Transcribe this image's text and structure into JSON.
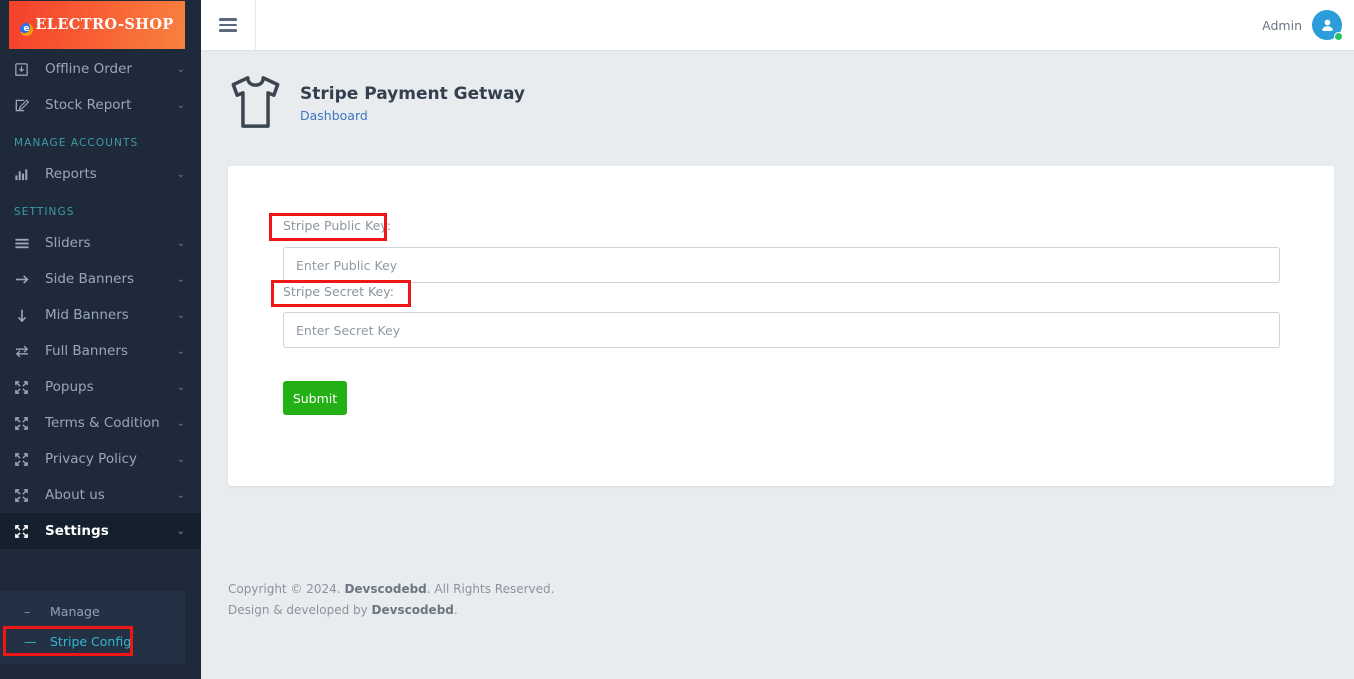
{
  "brand": {
    "logo_badge": "e",
    "logo_text": "ELECTRO-SHOP",
    "logo_gradient_from": "#f4402b",
    "logo_gradient_to": "#f9813f"
  },
  "topbar": {
    "hamburger_icon": "hamburger-icon",
    "user_name": "Admin",
    "avatar_icon": "user-avatar-icon",
    "status_color": "#22c55e"
  },
  "sidebar": {
    "background": "#1e2a3a",
    "accent": "#2fb8cf",
    "items": [
      {
        "label": "Offline Order",
        "icon": "inbox-download-icon",
        "chevron": "⌄",
        "has_children": true
      },
      {
        "label": "Stock Report",
        "icon": "edit-square-icon",
        "chevron": "⌄",
        "has_children": true
      }
    ],
    "section_manage_accounts": "MANAGE ACCOUNTS",
    "items_manage": [
      {
        "label": "Reports",
        "icon": "bar-chart-icon",
        "chevron": "⌄",
        "has_children": true
      }
    ],
    "section_settings": "SETTINGS",
    "items_settings": [
      {
        "label": "Sliders",
        "icon": "bars-icon",
        "chevron": "⌄",
        "has_children": true
      },
      {
        "label": "Side Banners",
        "icon": "arrow-right-icon",
        "chevron": "⌄",
        "has_children": true
      },
      {
        "label": "Mid Banners",
        "icon": "arrow-down-icon",
        "chevron": "⌄",
        "has_children": true
      },
      {
        "label": "Full Banners",
        "icon": "exchange-arrows-icon",
        "chevron": "⌄",
        "has_children": true
      },
      {
        "label": "Popups",
        "icon": "expand-arrows-icon",
        "chevron": "⌄",
        "has_children": true
      },
      {
        "label": "Terms & Codition",
        "icon": "expand-arrows-icon",
        "chevron": "⌄",
        "has_children": true
      },
      {
        "label": "Privacy Policy",
        "icon": "expand-arrows-icon",
        "chevron": "⌄",
        "has_children": true
      },
      {
        "label": "About us",
        "icon": "expand-arrows-icon",
        "chevron": "⌄",
        "has_children": true
      },
      {
        "label": "Settings",
        "icon": "expand-arrows-icon",
        "chevron": "⌄",
        "has_children": true,
        "active": true
      }
    ],
    "settings_submenu": [
      {
        "label": "Manage",
        "marker": "–",
        "current": false
      },
      {
        "label": "Stripe Config",
        "marker": "—",
        "current": true
      }
    ]
  },
  "page": {
    "icon": "tshirt-icon",
    "title": "Stripe Payment Getway",
    "breadcrumb": "Dashboard"
  },
  "form": {
    "public_key_label": "Stripe Public Key:",
    "public_key_value": "",
    "public_key_placeholder": "Enter Public Key",
    "secret_key_label": "Stripe Secret Key:",
    "secret_key_value": "",
    "secret_key_placeholder": "Enter Secret Key",
    "submit_label": "Submit",
    "submit_color": "#22b014"
  },
  "footer": {
    "line1_pre": "Copyright © 2024. ",
    "line1_brand": "Devscodebd",
    "line1_post": ". All Rights Reserved.",
    "line2_pre": "Design & developed by ",
    "line2_brand": "Devscodebd",
    "line2_post": "."
  },
  "annotations": {
    "color": "#f01616",
    "boxes": [
      {
        "name": "annotation-public-key-label"
      },
      {
        "name": "annotation-secret-key-label"
      },
      {
        "name": "annotation-stripe-config-menu"
      }
    ]
  }
}
